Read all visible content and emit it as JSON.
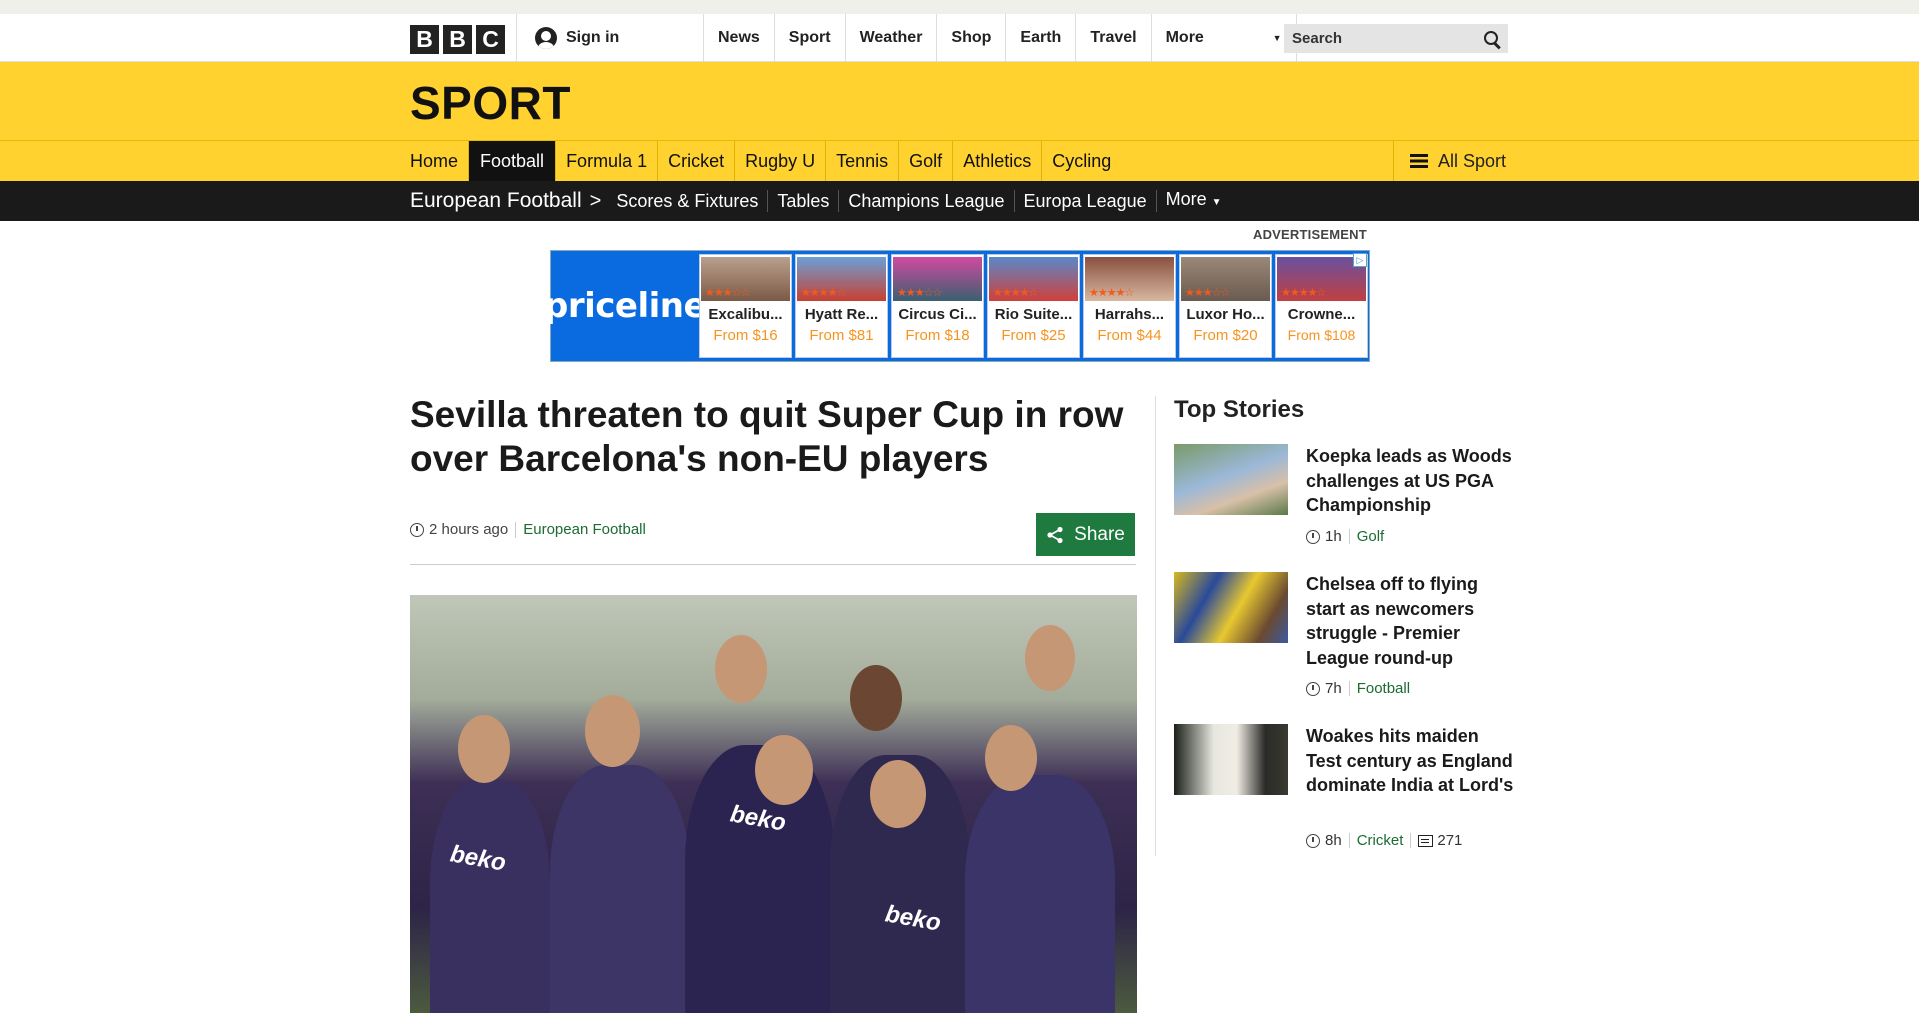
{
  "bbc": {
    "logo_letters": [
      "B",
      "B",
      "C"
    ],
    "signin_label": "Sign in",
    "nav": [
      {
        "label": "News"
      },
      {
        "label": "Sport"
      },
      {
        "label": "Weather"
      },
      {
        "label": "Shop"
      },
      {
        "label": "Earth"
      },
      {
        "label": "Travel"
      }
    ],
    "more_label": "More",
    "search_placeholder": "Search"
  },
  "sport": {
    "title": "SPORT",
    "nav": [
      {
        "label": "Home",
        "active": false
      },
      {
        "label": "Football",
        "active": true
      },
      {
        "label": "Formula 1",
        "active": false
      },
      {
        "label": "Cricket",
        "active": false
      },
      {
        "label": "Rugby U",
        "active": false
      },
      {
        "label": "Tennis",
        "active": false
      },
      {
        "label": "Golf",
        "active": false
      },
      {
        "label": "Athletics",
        "active": false
      },
      {
        "label": "Cycling",
        "active": false
      }
    ],
    "all_sport_label": "All Sport"
  },
  "subnav": {
    "section": "European Football",
    "links": [
      "Scores & Fixtures",
      "Tables",
      "Champions League",
      "Europa League"
    ],
    "more_label": "More"
  },
  "ad": {
    "label": "ADVERTISEMENT",
    "brand": "priceline",
    "hotels": [
      {
        "name": "Excalibu...",
        "price": "From $16"
      },
      {
        "name": "Hyatt Re...",
        "price": "From $81"
      },
      {
        "name": "Circus Ci...",
        "price": "From $18"
      },
      {
        "name": "Rio Suite...",
        "price": "From $25"
      },
      {
        "name": "Harrahs...",
        "price": "From $44"
      },
      {
        "name": "Luxor Ho...",
        "price": "From $20"
      },
      {
        "name": "Crowne...",
        "price": "From $108"
      }
    ]
  },
  "article": {
    "headline": "Sevilla threaten to quit Super Cup in row over Barcelona's non-EU players",
    "time": "2 hours ago",
    "topic": "European Football",
    "share_label": "Share"
  },
  "top_stories": {
    "title": "Top Stories",
    "items": [
      {
        "title": "Koepka leads as Woods challenges at US PGA Championship",
        "time": "1h",
        "topic": "Golf",
        "comments": ""
      },
      {
        "title": "Chelsea off to flying start as newcomers struggle - Premier League round-up",
        "time": "7h",
        "topic": "Football",
        "comments": ""
      },
      {
        "title": "Woakes hits maiden Test century as England dominate India at Lord's",
        "time": "8h",
        "topic": "Cricket",
        "comments": "271"
      }
    ]
  },
  "colors": {
    "sport_yellow": "#ffd230",
    "subnav_black": "#1a1a1a",
    "share_green": "#1f7a3f",
    "priceline_blue": "#0a6be0",
    "price_orange": "#f7931e"
  }
}
